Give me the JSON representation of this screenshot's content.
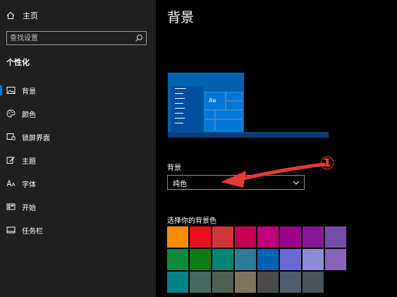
{
  "sidebar": {
    "home_label": "主页",
    "search_placeholder": "查找设置",
    "section_title": "个性化",
    "items": [
      {
        "label": "背景",
        "icon": "picture-icon",
        "active": true
      },
      {
        "label": "颜色",
        "icon": "palette-icon",
        "active": false
      },
      {
        "label": "锁屏界面",
        "icon": "lock-screen-icon",
        "active": false
      },
      {
        "label": "主题",
        "icon": "brush-icon",
        "active": false
      },
      {
        "label": "字体",
        "icon": "font-icon",
        "active": false
      },
      {
        "label": "开始",
        "icon": "start-icon",
        "active": false
      },
      {
        "label": "任务栏",
        "icon": "taskbar-icon",
        "active": false
      }
    ]
  },
  "main": {
    "title": "背景",
    "preview_tile_text": "Aa",
    "background_label": "背景",
    "background_value": "纯色",
    "annotation_number": "①",
    "swatch_label": "选择你的背景色",
    "swatches": [
      [
        "#ff8c00",
        "#e81123",
        "#d13438",
        "#c30052",
        "#bf0077",
        "#9a0089",
        "#881798",
        "#744da9"
      ],
      [
        "#10893e",
        "#107c10",
        "#018574",
        "#2d7d9a",
        "#0063b1",
        "#6b69d6",
        "#8e8cd8",
        "#8764b8"
      ],
      [
        "#038387",
        "#486860",
        "#525e54",
        "#7e735f",
        "#4c4a48",
        "#515c6b",
        "#4a5459"
      ]
    ]
  },
  "colors": {
    "accent": "#0078d7",
    "annotation": "#e53935"
  }
}
